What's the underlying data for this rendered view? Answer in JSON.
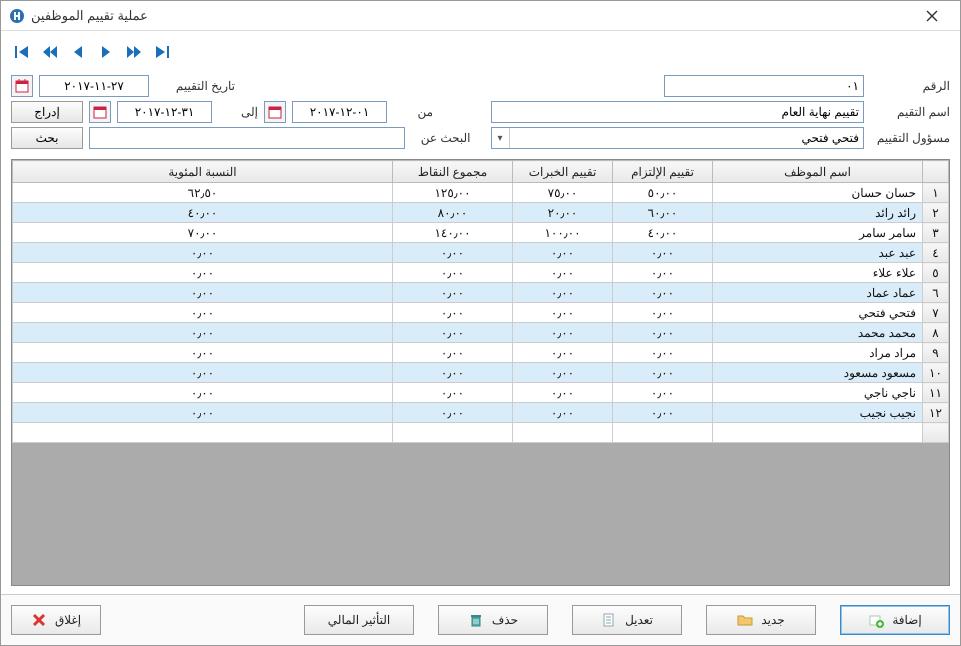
{
  "window": {
    "title": "عملية تقييم الموظفين"
  },
  "nav": {},
  "form": {
    "number_label": "الرقم",
    "number_value": "٠١",
    "eval_date_label": "تاريخ التقييم",
    "eval_date_value": "٢٧-١١-٢٠١٧",
    "eval_name_label": "اسم التقيم",
    "eval_name_value": "تقييم نهاية العام",
    "from_label": "من",
    "from_value": "٠١-١٢-٢٠١٧",
    "to_label": "إلى",
    "to_value": "٣١-١٢-٢٠١٧",
    "insert_btn": "إدراج",
    "supervisor_label": "مسؤول التقييم",
    "supervisor_value": "فتحي فتحي",
    "search_label": "البحث عن",
    "search_value": "",
    "search_btn": "بحث"
  },
  "grid": {
    "headers": {
      "name": "اسم الموظف",
      "commitment": "تقييم الإلتزام",
      "experience": "تقييم الخبرات",
      "points": "مجموع النقاط",
      "percent": "النسبة المئوية"
    },
    "rows": [
      {
        "n": "١",
        "name": "حسان حسان",
        "commit": "٥٠٫٠٠",
        "exp": "٧٥٫٠٠",
        "pts": "١٢٥٫٠٠",
        "pct": "٦٢٫٥٠"
      },
      {
        "n": "٢",
        "name": "رائد رائد",
        "commit": "٦٠٫٠٠",
        "exp": "٢٠٫٠٠",
        "pts": "٨٠٫٠٠",
        "pct": "٤٠٫٠٠"
      },
      {
        "n": "٣",
        "name": "سامر سامر",
        "commit": "٤٠٫٠٠",
        "exp": "١٠٠٫٠٠",
        "pts": "١٤٠٫٠٠",
        "pct": "٧٠٫٠٠"
      },
      {
        "n": "٤",
        "name": "عبد عبد",
        "commit": "٠٫٠٠",
        "exp": "٠٫٠٠",
        "pts": "٠٫٠٠",
        "pct": "٠٫٠٠"
      },
      {
        "n": "٥",
        "name": "علاء علاء",
        "commit": "٠٫٠٠",
        "exp": "٠٫٠٠",
        "pts": "٠٫٠٠",
        "pct": "٠٫٠٠"
      },
      {
        "n": "٦",
        "name": "عماد عماد",
        "commit": "٠٫٠٠",
        "exp": "٠٫٠٠",
        "pts": "٠٫٠٠",
        "pct": "٠٫٠٠"
      },
      {
        "n": "٧",
        "name": "فتحي فتحي",
        "commit": "٠٫٠٠",
        "exp": "٠٫٠٠",
        "pts": "٠٫٠٠",
        "pct": "٠٫٠٠"
      },
      {
        "n": "٨",
        "name": "محمد محمد",
        "commit": "٠٫٠٠",
        "exp": "٠٫٠٠",
        "pts": "٠٫٠٠",
        "pct": "٠٫٠٠"
      },
      {
        "n": "٩",
        "name": "مراد مراد",
        "commit": "٠٫٠٠",
        "exp": "٠٫٠٠",
        "pts": "٠٫٠٠",
        "pct": "٠٫٠٠"
      },
      {
        "n": "١٠",
        "name": "مسعود مسعود",
        "commit": "٠٫٠٠",
        "exp": "٠٫٠٠",
        "pts": "٠٫٠٠",
        "pct": "٠٫٠٠"
      },
      {
        "n": "١١",
        "name": "ناجي ناجي",
        "commit": "٠٫٠٠",
        "exp": "٠٫٠٠",
        "pts": "٠٫٠٠",
        "pct": "٠٫٠٠"
      },
      {
        "n": "١٢",
        "name": "نجيب نجيب",
        "commit": "٠٫٠٠",
        "exp": "٠٫٠٠",
        "pts": "٠٫٠٠",
        "pct": "٠٫٠٠"
      }
    ]
  },
  "footer": {
    "add": "إضافة",
    "new": "جديد",
    "edit": "تعديل",
    "delete": "حذف",
    "financial": "التأثير المالي",
    "close": "إغلاق"
  }
}
